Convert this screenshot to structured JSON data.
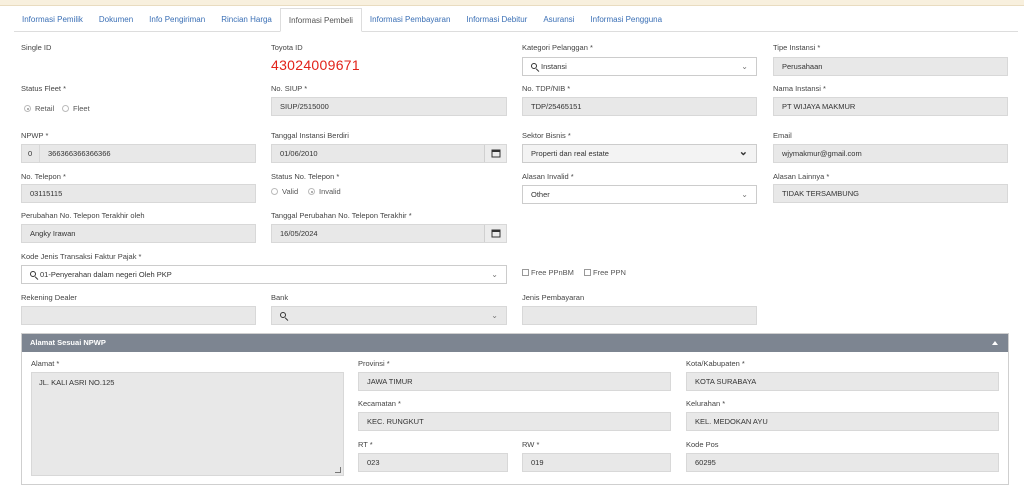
{
  "tabs": [
    "Informasi Pemilik",
    "Dokumen",
    "Info Pengiriman",
    "Rincian Harga",
    "Informasi Pembeli",
    "Informasi Pembayaran",
    "Informasi Debitur",
    "Asuransi",
    "Informasi Pengguna"
  ],
  "active_tab": "Informasi Pembeli",
  "fields": {
    "single_id": {
      "label": "Single ID"
    },
    "toyota_id": {
      "label": "Toyota ID",
      "value": "43024009671"
    },
    "kategori_pelanggan": {
      "label": "Kategori Pelanggan *",
      "value": "Instansi"
    },
    "tipe_instansi": {
      "label": "Tipe Instansi *",
      "value": "Perusahaan"
    },
    "status_fleet": {
      "label": "Status Fleet *",
      "options": [
        "Retail",
        "Fleet"
      ],
      "selected": "Retail"
    },
    "no_siup": {
      "label": "No. SIUP *",
      "value": "SIUP/2515000"
    },
    "no_tdp": {
      "label": "No. TDP/NIB *",
      "value": "TDP/25465151"
    },
    "nama_instansi": {
      "label": "Nama Instansi *",
      "value": "PT WIJAYA MAKMUR"
    },
    "npwp": {
      "label": "NPWP *",
      "prefix": "0",
      "value": "366366366366366"
    },
    "tanggal_instansi": {
      "label": "Tanggal Instansi Berdiri",
      "value": "01/06/2010"
    },
    "sektor_bisnis": {
      "label": "Sektor Bisnis *",
      "value": "Properti dan real estate"
    },
    "email": {
      "label": "Email",
      "value": "wjymakmur@gmail.com"
    },
    "no_telepon": {
      "label": "No. Telepon *",
      "value": "03115115"
    },
    "status_telepon": {
      "label": "Status No. Telepon *",
      "options": [
        "Valid",
        "Invalid"
      ],
      "selected": "Invalid"
    },
    "alasan_invalid": {
      "label": "Alasan Invalid *",
      "value": "Other"
    },
    "alasan_lainnya": {
      "label": "Alasan Lainnya *",
      "value": "TIDAK TERSAMBUNG"
    },
    "perubahan_oleh": {
      "label": "Perubahan No. Telepon Terakhir oleh",
      "value": "Angky Irawan"
    },
    "tanggal_perubahan": {
      "label": "Tanggal Perubahan No. Telepon Terakhir *",
      "value": "16/05/2024"
    },
    "kode_jenis": {
      "label": "Kode Jenis Transaksi Faktur Pajak *",
      "value": "01-Penyerahan dalam negeri Oleh PKP"
    },
    "free_ppnbm": {
      "label": "Free PPnBM"
    },
    "free_ppn": {
      "label": "Free PPN"
    },
    "rekening_dealer": {
      "label": "Rekening Dealer"
    },
    "bank": {
      "label": "Bank"
    },
    "jenis_pembayaran": {
      "label": "Jenis Pembayaran"
    }
  },
  "alamat": {
    "title": "Alamat Sesuai NPWP",
    "alamat": {
      "label": "Alamat *",
      "value": "JL. KALI ASRI NO.125"
    },
    "provinsi": {
      "label": "Provinsi *",
      "value": "JAWA TIMUR"
    },
    "kota": {
      "label": "Kota/Kabupaten *",
      "value": "KOTA SURABAYA"
    },
    "kecamatan": {
      "label": "Kecamatan *",
      "value": "KEC. RUNGKUT"
    },
    "kelurahan": {
      "label": "Kelurahan *",
      "value": "KEL. MEDOKAN AYU"
    },
    "rt": {
      "label": "RT *",
      "value": "023"
    },
    "rw": {
      "label": "RW *",
      "value": "019"
    },
    "kode_pos": {
      "label": "Kode Pos",
      "value": "60295"
    }
  },
  "colors": {
    "tab_link": "#3a6fb5",
    "accent_red": "#e2231a",
    "panel_header": "#7d8591"
  }
}
